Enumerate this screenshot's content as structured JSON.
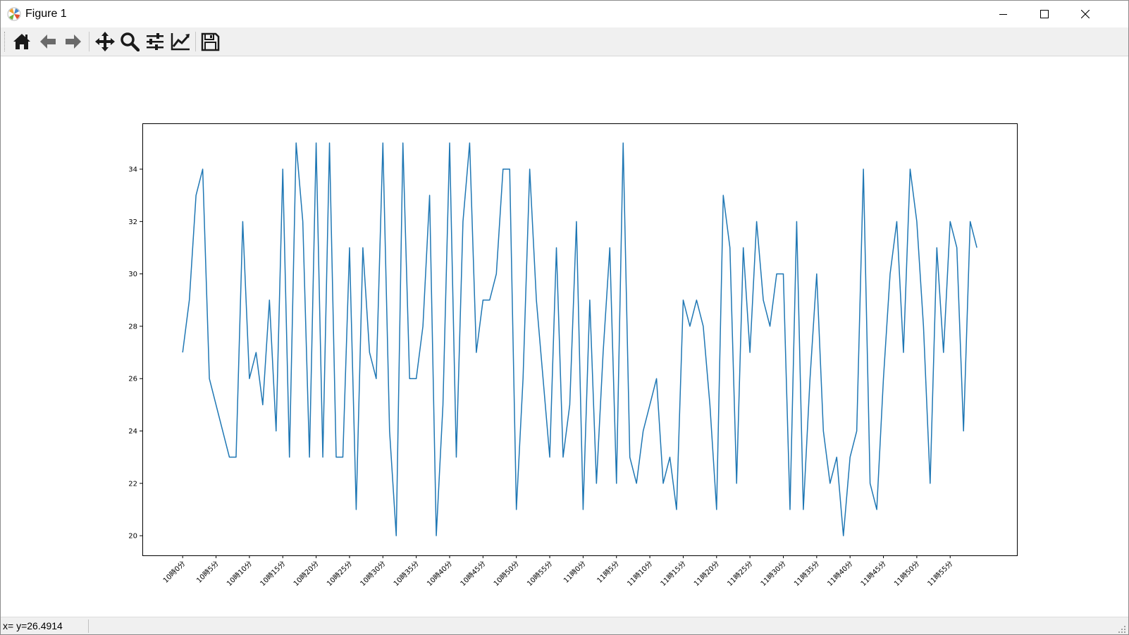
{
  "window": {
    "title": "Figure 1"
  },
  "toolbar": {
    "buttons": [
      {
        "name": "home-icon"
      },
      {
        "name": "back-arrow-icon"
      },
      {
        "name": "forward-arrow-icon"
      },
      {
        "name": "pan-icon"
      },
      {
        "name": "zoom-icon"
      },
      {
        "name": "subplots-config-icon"
      },
      {
        "name": "edit-axis-icon"
      },
      {
        "name": "save-icon"
      }
    ]
  },
  "status": {
    "coordinates": "x= y=26.4914"
  },
  "colors": {
    "line": "#1f77b4",
    "toolbar_bg": "#f0f0f0",
    "icon": "#1a1a1a"
  },
  "chart_data": {
    "type": "line",
    "title": "",
    "xlabel": "",
    "ylabel": "",
    "ylim": [
      19.25,
      35.75
    ],
    "yticks": [
      20,
      22,
      24,
      26,
      28,
      30,
      32,
      34
    ],
    "xtick_labels": [
      "10時0分",
      "10時5分",
      "10時10分",
      "10時15分",
      "10時20分",
      "10時25分",
      "10時30分",
      "10時35分",
      "10時40分",
      "10時45分",
      "10時50分",
      "10時55分",
      "11時0分",
      "11時5分",
      "11時10分",
      "11時15分",
      "11時20分",
      "11時25分",
      "11時30分",
      "11時35分",
      "11時40分",
      "11時45分",
      "11時50分",
      "11時55分"
    ],
    "xtick_step": 5,
    "grid": false,
    "legend": "none",
    "series": [
      {
        "values": [
          27,
          29,
          33,
          34,
          26,
          25,
          24,
          23,
          23,
          32,
          26,
          27,
          25,
          29,
          24,
          34,
          23,
          35,
          32,
          23,
          35,
          23,
          35,
          23,
          23,
          31,
          21,
          31,
          27,
          26,
          35,
          24,
          20,
          35,
          26,
          26,
          28,
          33,
          20,
          25,
          35,
          23,
          32,
          35,
          27,
          29,
          29,
          30,
          34,
          34,
          21,
          26,
          34,
          29,
          26,
          23,
          31,
          23,
          25,
          32,
          21,
          29,
          22,
          27,
          31,
          22,
          35,
          23,
          22,
          24,
          25,
          26,
          22,
          23,
          21,
          29,
          28,
          29,
          28,
          25,
          21,
          33,
          31,
          22,
          31,
          27,
          32,
          29,
          28,
          30,
          30,
          21,
          32,
          21,
          26,
          30,
          24,
          22,
          23,
          20,
          23,
          24,
          34,
          22,
          21,
          26,
          30,
          32,
          27,
          34,
          32,
          28,
          22,
          31,
          27,
          32,
          31,
          24,
          32,
          31
        ]
      }
    ]
  }
}
